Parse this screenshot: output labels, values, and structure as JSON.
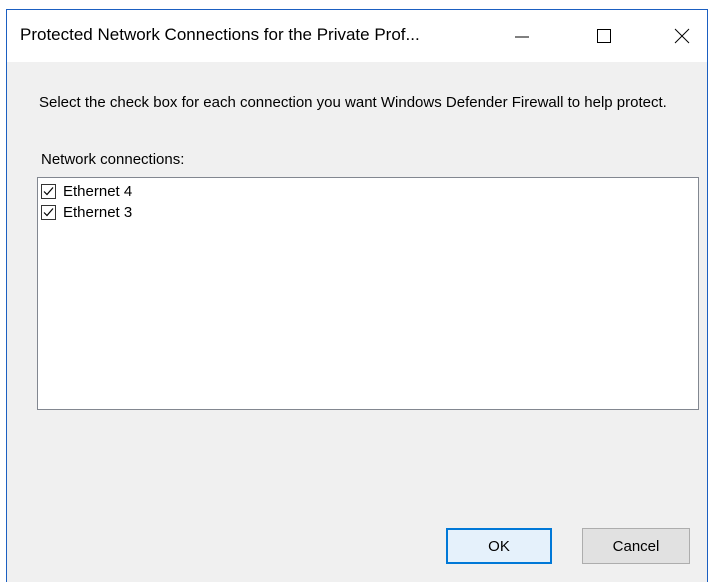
{
  "window": {
    "title": "Protected Network Connections for the Private Prof...",
    "minimize_icon": "minimize-icon",
    "maximize_icon": "maximize-icon",
    "close_icon": "close-icon"
  },
  "instruction": "Select the check box for each connection you want Windows Defender Firewall to help protect.",
  "list": {
    "label": "Network connections:",
    "items": [
      {
        "label": "Ethernet 4",
        "checked": true
      },
      {
        "label": "Ethernet 3",
        "checked": true
      }
    ]
  },
  "buttons": {
    "ok": "OK",
    "cancel": "Cancel"
  },
  "colors": {
    "accent_border": "#1b5fc1",
    "default_button_border": "#0078d7",
    "dialog_background": "#f0f0f0"
  }
}
